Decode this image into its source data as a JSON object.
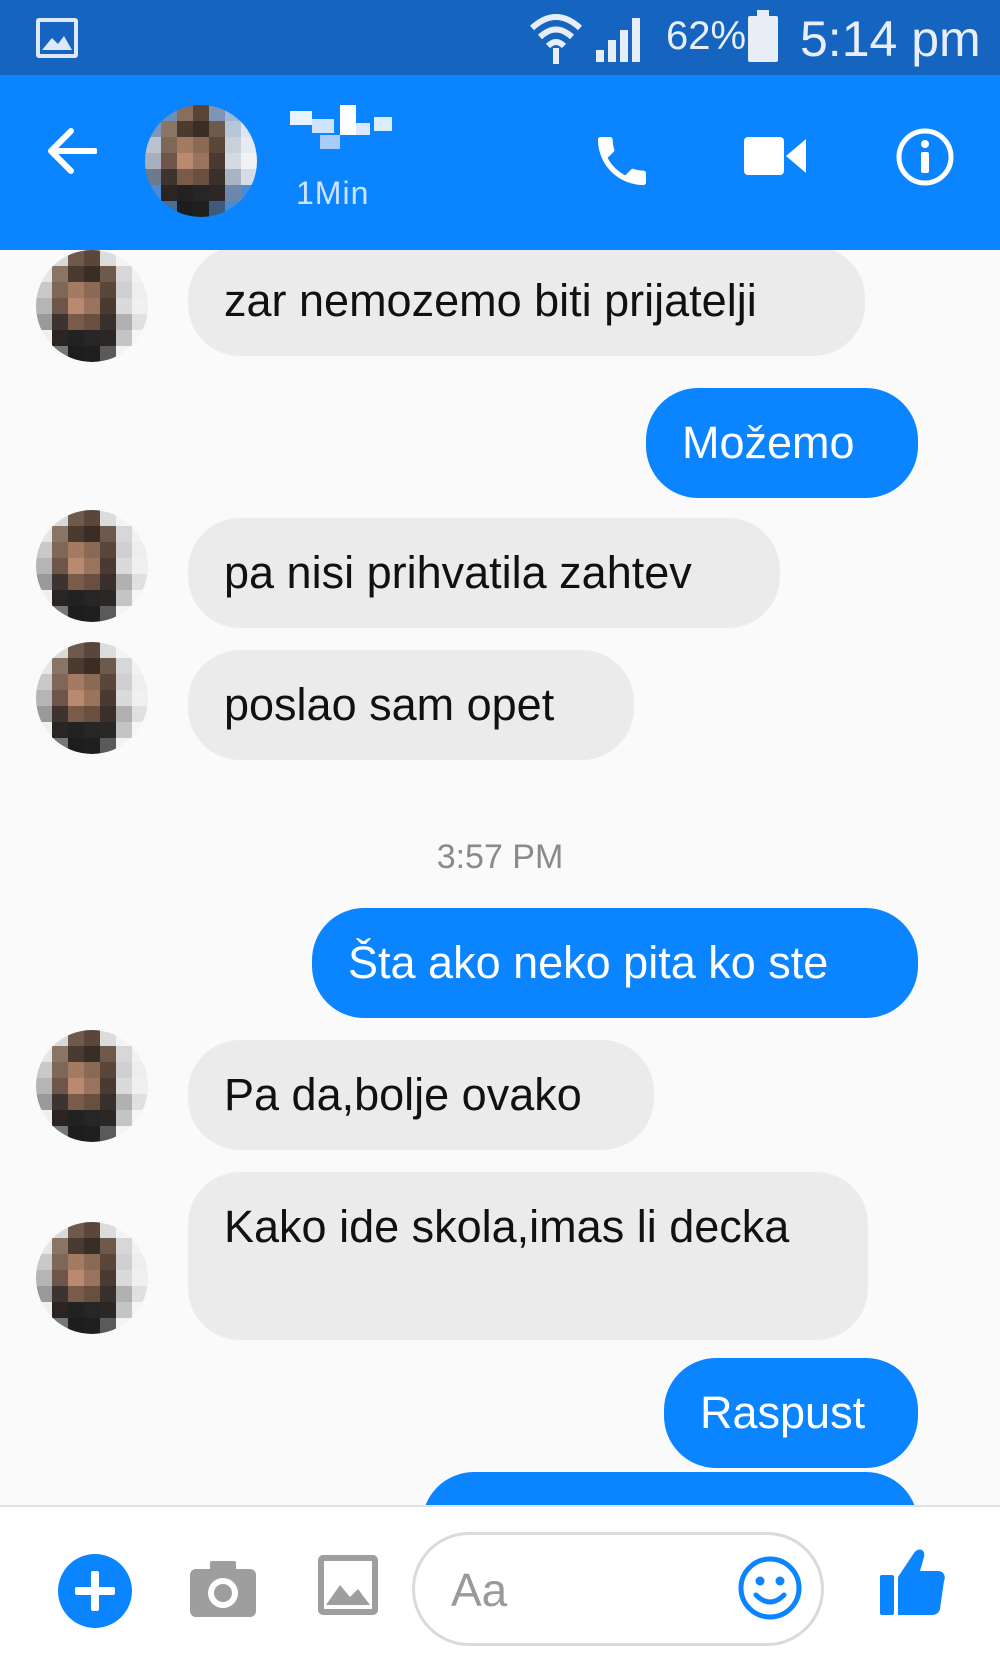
{
  "status_bar": {
    "battery_percent": "62%",
    "time": "5:14 pm",
    "icons": [
      "gallery-icon",
      "wifi-icon",
      "signal-icon",
      "battery-icon"
    ]
  },
  "header": {
    "subtitle": "1Min",
    "icons": [
      "back-arrow-icon",
      "phone-icon",
      "video-camera-icon",
      "info-icon"
    ]
  },
  "conversation": {
    "messages": [
      {
        "direction": "incoming",
        "text": "zar nemozemo biti prijatelji"
      },
      {
        "direction": "outgoing",
        "text": "Možemo"
      },
      {
        "direction": "incoming",
        "text": "pa nisi prihvatila zahtev"
      },
      {
        "direction": "incoming",
        "text": "poslao sam opet"
      },
      {
        "direction": "outgoing",
        "text": "Šta ako neko pita ko ste"
      },
      {
        "direction": "incoming",
        "text": "Pa da,bolje ovako"
      },
      {
        "direction": "incoming",
        "text": "Kako ide skola,imas li decka"
      },
      {
        "direction": "outgoing",
        "text": "Raspust"
      }
    ],
    "timestamp": "3:57 PM"
  },
  "composer": {
    "placeholder": "Aa",
    "icons": [
      "plus-icon",
      "camera-icon",
      "image-icon",
      "emoji-icon",
      "thumbs-up-icon"
    ]
  },
  "colors": {
    "status_bar": "#1565c0",
    "header": "#0a84ff",
    "outgoing_bubble": "#0a84ff",
    "incoming_bubble": "#ebebeb",
    "background": "#fafafa"
  }
}
